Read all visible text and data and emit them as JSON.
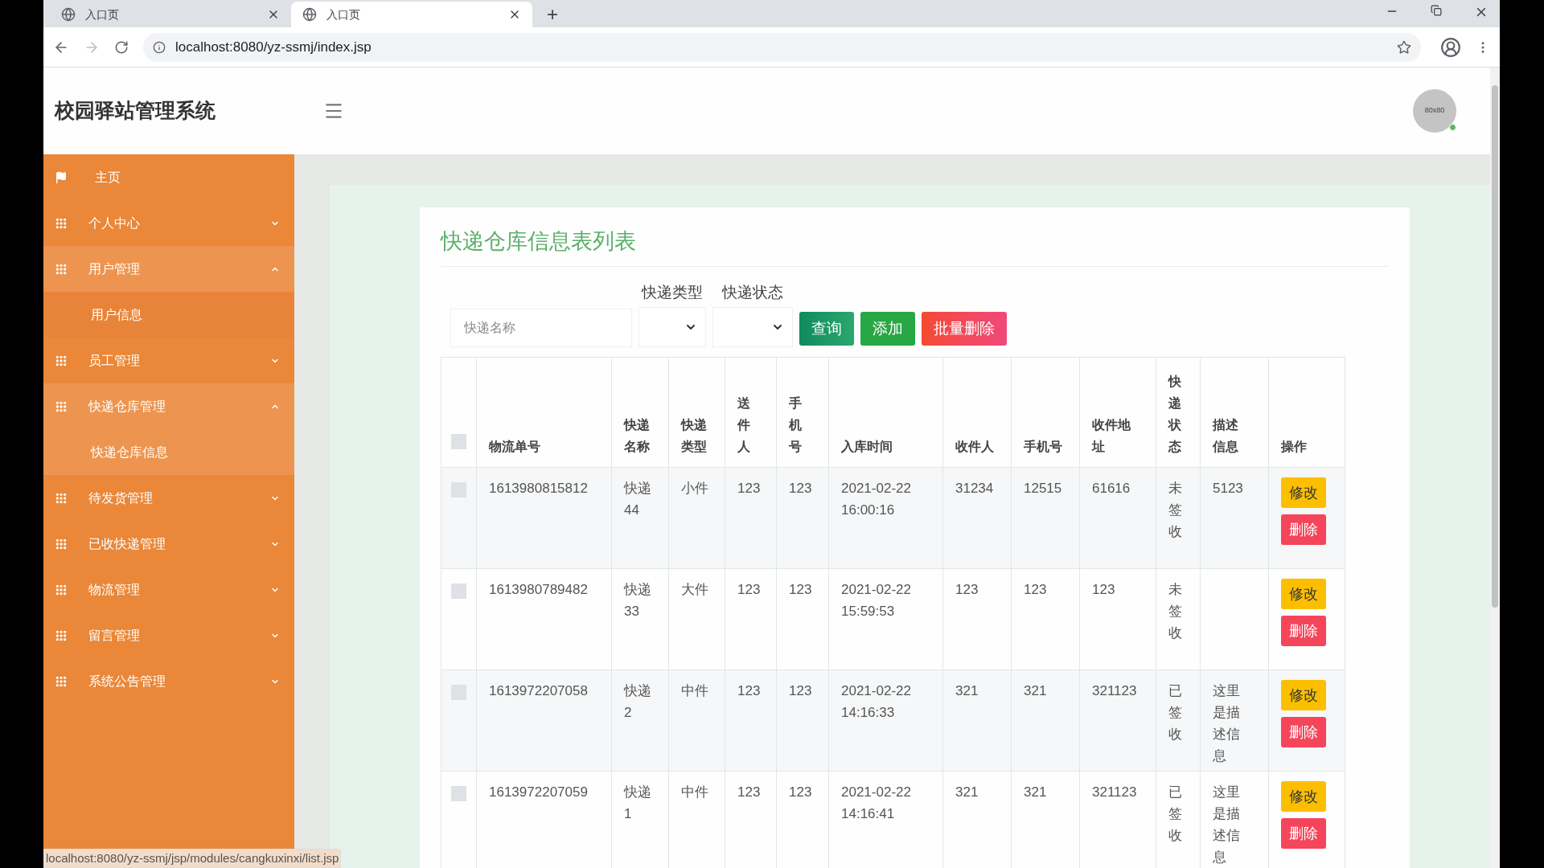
{
  "browser": {
    "tabs": [
      {
        "title": "入口页",
        "selected": false
      },
      {
        "title": "入口页",
        "selected": true
      }
    ],
    "new_tab": "+",
    "url": "localhost:8080/yz-ssmj/index.jsp",
    "status_link": "localhost:8080/yz-ssmj/jsp/modules/cangkuxinxi/list.jsp"
  },
  "header": {
    "title": "校园驿站管理系统",
    "avatar": "80x80"
  },
  "sidebar": {
    "items": [
      {
        "label": "主页",
        "kind": "link"
      },
      {
        "label": "个人中心",
        "kind": "group",
        "expanded": false
      },
      {
        "label": "用户管理",
        "kind": "group",
        "expanded": true,
        "children": [
          {
            "label": "用户信息",
            "selected": false
          }
        ]
      },
      {
        "label": "员工管理",
        "kind": "group",
        "expanded": false
      },
      {
        "label": "快递仓库管理",
        "kind": "group",
        "expanded": true,
        "children": [
          {
            "label": "快递仓库信息",
            "selected": true
          }
        ]
      },
      {
        "label": "待发货管理",
        "kind": "group",
        "expanded": false
      },
      {
        "label": "已收快递管理",
        "kind": "group",
        "expanded": false
      },
      {
        "label": "物流管理",
        "kind": "group",
        "expanded": false
      },
      {
        "label": "留言管理",
        "kind": "group",
        "expanded": false
      },
      {
        "label": "系统公告管理",
        "kind": "group",
        "expanded": false
      }
    ]
  },
  "page_title": "快递仓库信息表列表",
  "filters": {
    "search": {
      "placeholder": "快递名称"
    },
    "selects": [
      {
        "label": "快递类型"
      },
      {
        "label": "快递状态"
      }
    ],
    "buttons": [
      {
        "label": "查询",
        "kind": "query"
      },
      {
        "label": "添加",
        "kind": "add"
      },
      {
        "label": "批量删除",
        "kind": "delete"
      }
    ]
  },
  "table": {
    "columns": [
      "物流单号",
      "快递名称",
      "快递类型",
      "送件人",
      "手机号",
      "入库时间",
      "收件人",
      "手机号",
      "收件地址",
      "快递状态",
      "描述信息",
      "操作"
    ],
    "select_all": {
      "checked": false
    },
    "rows": [
      {
        "checked": false,
        "cells": [
          "1613980815812",
          "快递44",
          "小件",
          "123",
          "123",
          "2021-02-22 16:00:16",
          "31234",
          "12515",
          "61616",
          "未签收",
          "5123"
        ],
        "actions": [
          "修改",
          "删除"
        ]
      },
      {
        "checked": false,
        "cells": [
          "1613980789482",
          "快递33",
          "大件",
          "123",
          "123",
          "2021-02-22 15:59:53",
          "123",
          "123",
          "123",
          "未签收",
          ""
        ],
        "actions": [
          "修改",
          "删除"
        ]
      },
      {
        "checked": false,
        "cells": [
          "1613972207058",
          "快递2",
          "中件",
          "123",
          "123",
          "2021-02-22 14:16:33",
          "321",
          "321",
          "321123",
          "已签收",
          "这里是描述信息"
        ],
        "actions": [
          "修改",
          "删除"
        ]
      },
      {
        "checked": false,
        "cells": [
          "1613972207059",
          "快递1",
          "中件",
          "123",
          "123",
          "2021-02-22 14:16:41",
          "321",
          "321",
          "321123",
          "已签收",
          "这里是描述信息"
        ],
        "actions": [
          "修改",
          "删除"
        ]
      }
    ]
  }
}
